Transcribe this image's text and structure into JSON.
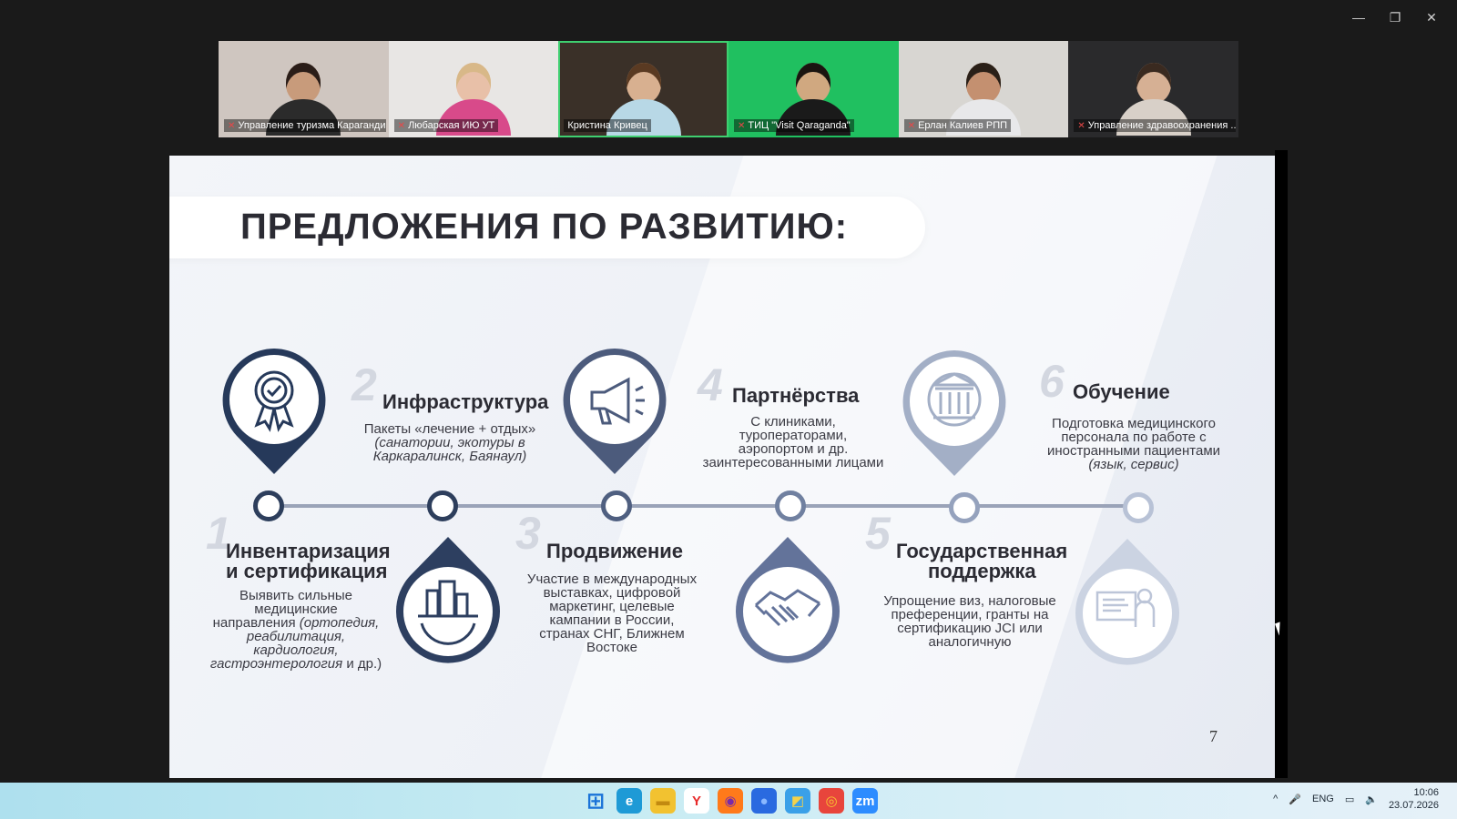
{
  "window": {
    "controls": [
      "—",
      "❐",
      "✕"
    ]
  },
  "participants": [
    {
      "name": "Управление туризма Караганди...",
      "muted": true,
      "bg": "#cfc6c0",
      "skin": "#c89b7b",
      "hair": "#2a1d18",
      "shirt": "#2b2b2b"
    },
    {
      "name": "Любарская ИЮ УТ",
      "muted": true,
      "bg": "#e8e6e4",
      "skin": "#e8c0a8",
      "hair": "#d8b888",
      "shirt": "#d84a8a"
    },
    {
      "name": "Кристина Кривец",
      "muted": false,
      "active": true,
      "bg": "#3a3028",
      "skin": "#d8b090",
      "hair": "#5a3a22",
      "shirt": "#b8d8e6"
    },
    {
      "name": "ТИЦ \"Visit Qaraganda\"",
      "muted": true,
      "bg": "#20c060",
      "skin": "#d0a880",
      "hair": "#1a1410",
      "shirt": "#1a1a1a"
    },
    {
      "name": "Ерлан Калиев РПП",
      "muted": true,
      "bg": "#d8d6d2",
      "skin": "#c49070",
      "hair": "#2a2018",
      "shirt": "#e8e8ea"
    },
    {
      "name": "Управление здравоохранения ...",
      "muted": true,
      "bg": "#2a2a2c",
      "skin": "#d6b094",
      "hair": "#3a2a20",
      "shirt": "#d8d0c8"
    }
  ],
  "slide": {
    "title": "ПРЕДЛОЖЕНИЯ ПО РАЗВИТИЮ:",
    "page_number": "7",
    "items": [
      {
        "num": "1",
        "heading_1": "Инвентаризация",
        "heading_2": "и сертификация",
        "desc_1": "Выявить сильные",
        "desc_2": "медицинские",
        "desc_3a": "направления ",
        "desc_3b": "(ортопедия,",
        "desc_4": "реабилитация,",
        "desc_5": "кардиология,",
        "desc_6a": "гастроэнтерология",
        "desc_6b": " и др.)",
        "icon": "certificate-badge-icon"
      },
      {
        "num": "2",
        "heading_1": "Инфраструктура",
        "desc_1": "Пакеты «лечение + отдых»",
        "desc_2": "(санатории, экотуры в",
        "desc_3": "Каркаралинск, Баянаул)",
        "icon": "city-gear-icon"
      },
      {
        "num": "3",
        "heading_1": "Продвижение",
        "desc_1": "Участие в международных",
        "desc_2": "выставках, цифровой",
        "desc_3": "маркетинг, целевые",
        "desc_4": "кампании в России,",
        "desc_5": "странах СНГ, Ближнем",
        "desc_6": "Востоке",
        "icon": "megaphone-icon"
      },
      {
        "num": "4",
        "heading_1": "Партнёрства",
        "desc_1": "С клиниками,",
        "desc_2": "туроператорами,",
        "desc_3": "аэропортом и др.",
        "desc_4": "заинтересованными лицами",
        "icon": "handshake-icon"
      },
      {
        "num": "5",
        "heading_1": "Государственная",
        "heading_2": "поддержка",
        "desc_1": "Упрощение виз, налоговые",
        "desc_2": "преференции, гранты на",
        "desc_3": "сертификацию JCI или",
        "desc_4": "аналогичную",
        "icon": "government-building-icon"
      },
      {
        "num": "6",
        "heading_1": "Обучение",
        "desc_1": "Подготовка медицинского",
        "desc_2": "персонала по работе с",
        "desc_3": "иностранными пациентами",
        "desc_4": "(язык, сервис)",
        "icon": "presentation-teacher-icon"
      }
    ]
  },
  "taskbar": {
    "apps": [
      {
        "name": "windows-start-icon",
        "glyph": "⊞",
        "bg": "transparent",
        "fg": "#1a73d8"
      },
      {
        "name": "edge-icon",
        "glyph": "e",
        "bg": "#1e9ad6",
        "fg": "#ffffff"
      },
      {
        "name": "file-explorer-icon",
        "glyph": "▬",
        "bg": "#f2c230",
        "fg": "#c28a10"
      },
      {
        "name": "yandex-browser-icon",
        "glyph": "Y",
        "bg": "#ffffff",
        "fg": "#e82a2a"
      },
      {
        "name": "firefox-icon",
        "glyph": "◉",
        "bg": "#ff7a1a",
        "fg": "#7a2aa8"
      },
      {
        "name": "app-blue-icon",
        "glyph": "●",
        "bg": "#2a6ae0",
        "fg": "#8ab8ff"
      },
      {
        "name": "photos-icon",
        "glyph": "◩",
        "bg": "#3aa0e8",
        "fg": "#f5d24a"
      },
      {
        "name": "chrome-icon",
        "glyph": "◎",
        "bg": "#e8453c",
        "fg": "#f8c830"
      },
      {
        "name": "zoom-icon",
        "glyph": "zm",
        "bg": "#2d8cff",
        "fg": "#ffffff"
      }
    ],
    "tray": {
      "chevron": "^",
      "mic": "🎤",
      "language": "ENG",
      "network": "▭",
      "volume": "🔈",
      "time": "10:06",
      "date": "23.07.2026"
    }
  }
}
